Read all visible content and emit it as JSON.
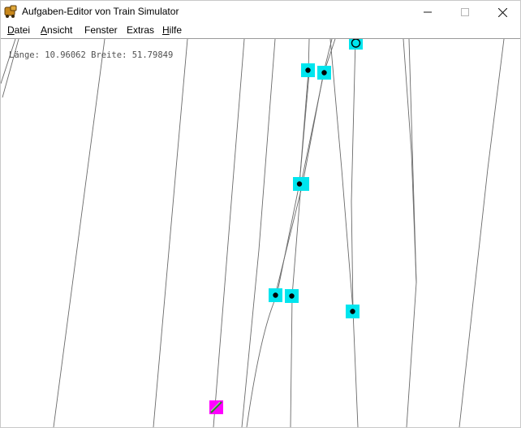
{
  "window": {
    "title": "Aufgaben-Editor von Train Simulator",
    "controls": {
      "minimize_icon": "minimize-icon",
      "maximize_icon": "maximize-icon",
      "close_icon": "close-icon"
    }
  },
  "menu": [
    {
      "label": "Datei",
      "accel": "D"
    },
    {
      "label": "Ansicht",
      "accel": "A"
    },
    {
      "label": "Fenster",
      "accel": ""
    },
    {
      "label": "Extras",
      "accel": ""
    },
    {
      "label": "Hilfe",
      "accel": "H"
    }
  ],
  "map": {
    "coordinates": "Länge: 10.96062 Breite: 51.79849",
    "colors": {
      "track": "#6a6a6a",
      "marker_fill": "#00e5ee",
      "marker_dot": "#000000",
      "start_marker": "#ff00ff"
    }
  }
}
